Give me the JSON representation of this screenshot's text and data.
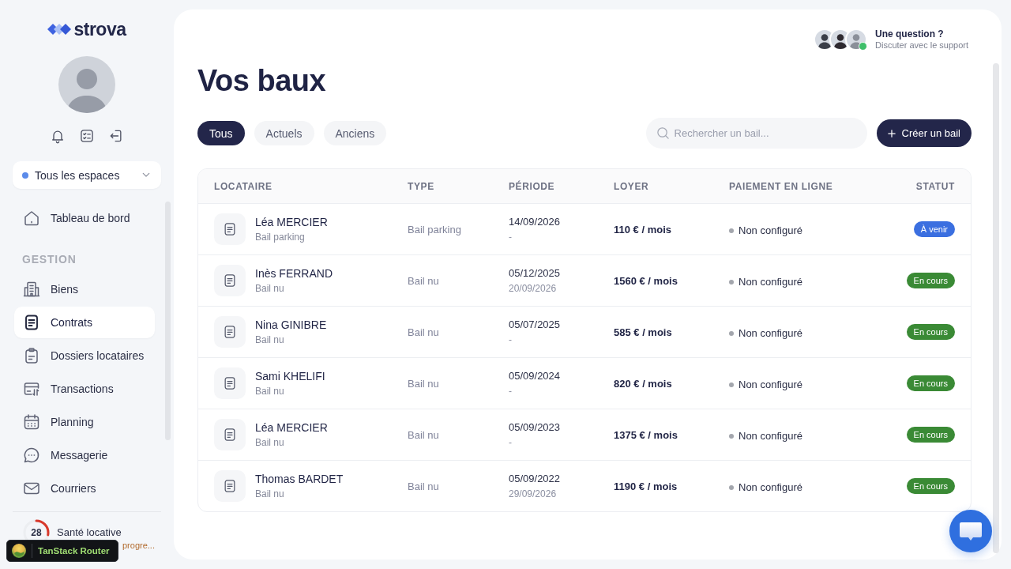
{
  "sidebar": {
    "logo": "strova",
    "space_selector": {
      "label": "Tous les espaces"
    },
    "nav": [
      {
        "label": "Tableau de bord",
        "selected": false
      }
    ],
    "section": {
      "title": "GESTION",
      "items": [
        {
          "label": "Biens",
          "selected": false
        },
        {
          "label": "Contrats",
          "selected": true
        },
        {
          "label": "Dossiers locataires",
          "selected": false
        },
        {
          "label": "Transactions",
          "selected": false
        },
        {
          "label": "Planning",
          "selected": false
        },
        {
          "label": "Messagerie",
          "selected": false
        },
        {
          "label": "Courriers",
          "selected": false
        }
      ]
    },
    "health": {
      "title": "Santé locative",
      "score": "28",
      "level": 0.28,
      "subtitle": "progre..."
    }
  },
  "support": {
    "title": "Une question ?",
    "subtitle": "Discuter avec le support",
    "online": true
  },
  "page": {
    "title": "Vos baux"
  },
  "tabs": [
    {
      "label": "Tous",
      "selected": true
    },
    {
      "label": "Actuels",
      "selected": false
    },
    {
      "label": "Anciens",
      "selected": false
    }
  ],
  "search": {
    "placeholder": "Rechercher un bail..."
  },
  "create_button": {
    "label": "Créer un bail"
  },
  "table": {
    "columns": [
      "LOCATAIRE",
      "TYPE",
      "PÉRIODE",
      "LOYER",
      "PAIEMENT EN LIGNE",
      "STATUT"
    ],
    "rows": [
      {
        "tenant": "Léa MERCIER",
        "lease": "Bail parking",
        "type": "Bail parking",
        "start": "14/09/2026",
        "end": "-",
        "rent": "110 € / mois",
        "payment": "Non configuré",
        "status": {
          "label": "À venir",
          "color": "#3b6fe0"
        }
      },
      {
        "tenant": "Inès FERRAND",
        "lease": "Bail nu",
        "type": "Bail nu",
        "start": "05/12/2025",
        "end": "20/09/2026",
        "rent": "1560 € / mois",
        "payment": "Non configuré",
        "status": {
          "label": "En cours",
          "color": "#3a8a35"
        }
      },
      {
        "tenant": "Nina GINIBRE",
        "lease": "Bail nu",
        "type": "Bail nu",
        "start": "05/07/2025",
        "end": "-",
        "rent": "585 € / mois",
        "payment": "Non configuré",
        "status": {
          "label": "En cours",
          "color": "#3a8a35"
        }
      },
      {
        "tenant": "Sami KHELIFI",
        "lease": "Bail nu",
        "type": "Bail nu",
        "start": "05/09/2024",
        "end": "-",
        "rent": "820 € / mois",
        "payment": "Non configuré",
        "status": {
          "label": "En cours",
          "color": "#3a8a35"
        }
      },
      {
        "tenant": "Léa MERCIER",
        "lease": "Bail nu",
        "type": "Bail nu",
        "start": "05/09/2023",
        "end": "-",
        "rent": "1375 € / mois",
        "payment": "Non configuré",
        "status": {
          "label": "En cours",
          "color": "#3a8a35"
        }
      },
      {
        "tenant": "Thomas BARDET",
        "lease": "Bail nu",
        "type": "Bail nu",
        "start": "05/09/2022",
        "end": "29/09/2026",
        "rent": "1190 € / mois",
        "payment": "Non configuré",
        "status": {
          "label": "En cours",
          "color": "#3a8a35"
        }
      }
    ]
  },
  "devtools": {
    "label": "TanStack Router"
  }
}
